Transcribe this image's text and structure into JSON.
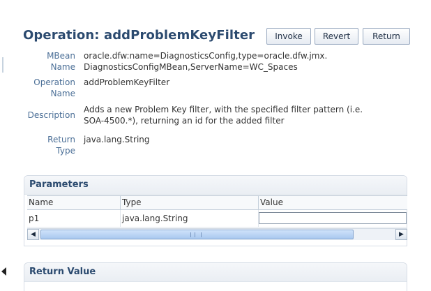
{
  "operation": {
    "title_prefix": "Operation:",
    "name": "addProblemKeyFilter"
  },
  "toolbar": {
    "invoke_label": "Invoke",
    "revert_label": "Revert",
    "return_label": "Return"
  },
  "details": {
    "mbean_label_1": "MBean",
    "mbean_label_2": "Name",
    "mbean_value_1": "oracle.dfw:name=DiagnosticsConfig,type=oracle.dfw.jmx.",
    "mbean_value_2": "DiagnosticsConfigMBean,ServerName=WC_Spaces",
    "opname_label_1": "Operation",
    "opname_label_2": "Name",
    "opname_value": "addProblemKeyFilter",
    "description_label": "Description",
    "description_value_1": "Adds a new Problem Key filter, with the specified filter pattern (i.e.",
    "description_value_2": "SOA-4500.*), returning an id for the added filter",
    "return_label_1": "Return",
    "return_label_2": "Type",
    "return_value": "java.lang.String"
  },
  "parameters": {
    "title": "Parameters",
    "columns": [
      "Name",
      "Type",
      "Value"
    ],
    "rows": [
      {
        "name": "p1",
        "type": "java.lang.String",
        "value": ""
      }
    ]
  },
  "return_value": {
    "title": "Return Value"
  }
}
